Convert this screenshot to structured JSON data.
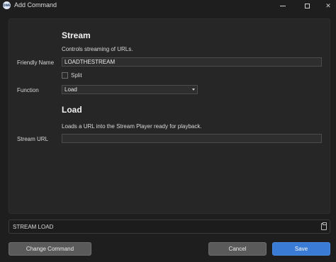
{
  "window": {
    "title": "Add Command",
    "app_icon_text": "OWE"
  },
  "stream_section": {
    "heading": "Stream",
    "description": "Controls streaming of URLs.",
    "friendly_name_label": "Friendly Name",
    "friendly_name_value": "LOADTHESTREAM",
    "split_label": "Split",
    "split_checked": false,
    "function_label": "Function",
    "function_value": "Load"
  },
  "load_section": {
    "heading": "Load",
    "description": "Loads a URL into the Stream Player ready for playback.",
    "stream_url_label": "Stream URL",
    "stream_url_value": ""
  },
  "status": {
    "text": "STREAM LOAD"
  },
  "buttons": {
    "change_command": "Change Command",
    "cancel": "Cancel",
    "save": "Save"
  },
  "colors": {
    "background": "#1e1e1e",
    "panel": "#262626",
    "accent": "#3a7bd5"
  }
}
